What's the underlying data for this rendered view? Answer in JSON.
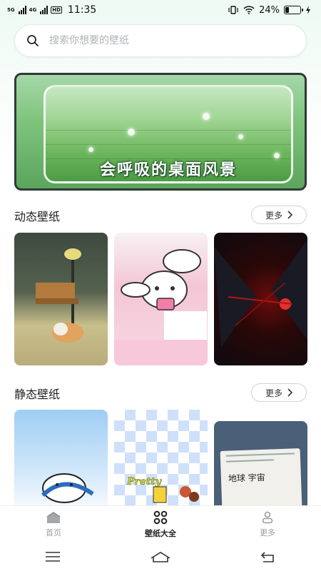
{
  "status_bar": {
    "sim1": "5G",
    "sim2": "4G",
    "hd": "HD",
    "time": "11:35",
    "battery_text": "24%",
    "battery_level": 0.24
  },
  "search": {
    "placeholder": "搜索你想要的壁纸"
  },
  "banner": {
    "text": "会呼吸的桌面风景"
  },
  "sections": {
    "dynamic": {
      "title": "动态壁纸",
      "more_label": "更多"
    },
    "static": {
      "title": "静态壁纸",
      "more_label": "更多"
    }
  },
  "static_cards": {
    "card2_text": "Pretty",
    "card3_text": "地球  宇宙"
  },
  "bottom_nav": {
    "items": [
      {
        "label": "首页",
        "icon": "home-icon",
        "active": false
      },
      {
        "label": "壁纸大全",
        "icon": "grid-icon",
        "active": true
      },
      {
        "label": "更多",
        "icon": "user-icon",
        "active": false
      }
    ]
  },
  "colors": {
    "accent_bg": "#eefaf3",
    "active_text": "#222222",
    "inactive_text": "#9a9da1"
  }
}
